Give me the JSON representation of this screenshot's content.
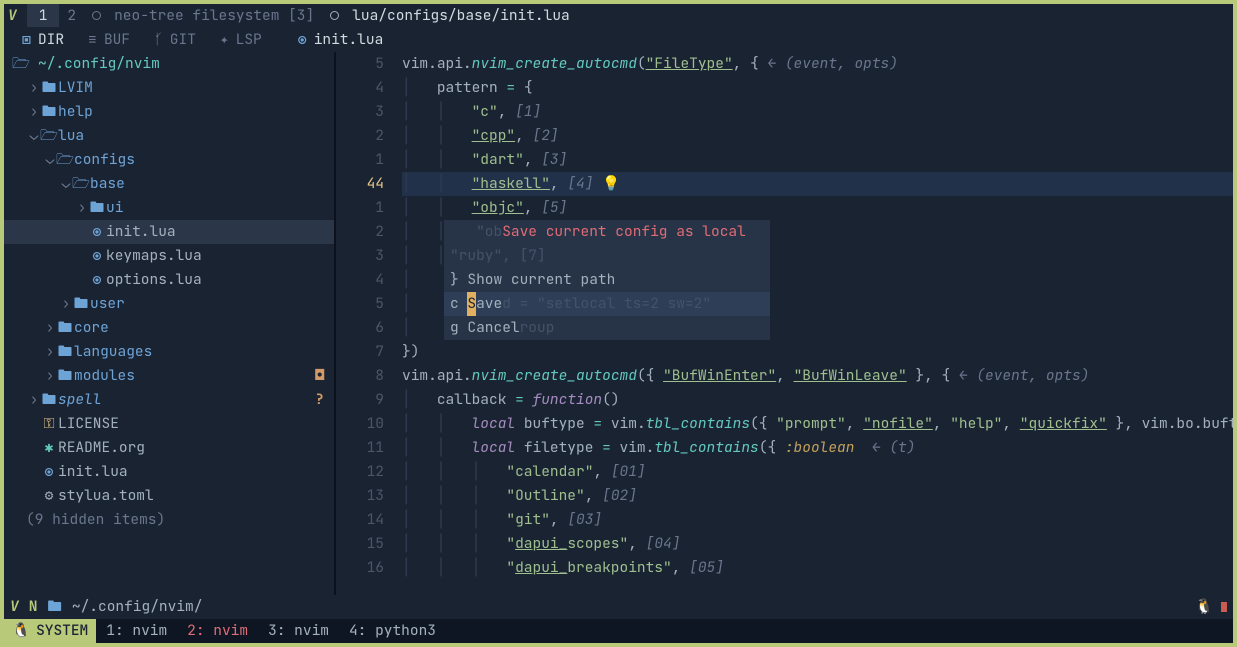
{
  "tabline": {
    "vim_glyph": "V",
    "active_tab": "1",
    "inactive_tab": "2",
    "buf1_label": "neo-tree filesystem [3]",
    "buf2_label": "lua/configs/base/init.lua"
  },
  "sidebar_tabs": {
    "dir": "DIR",
    "buf": "BUF",
    "git": "GIT",
    "lsp": "LSP"
  },
  "filetab": {
    "name": "init.lua"
  },
  "tree": {
    "root": "~/.config/nvim",
    "items": [
      {
        "depth": 1,
        "type": "dir",
        "open": false,
        "name": "LVIM"
      },
      {
        "depth": 1,
        "type": "dir",
        "open": false,
        "name": "help"
      },
      {
        "depth": 1,
        "type": "dir",
        "open": true,
        "name": "lua"
      },
      {
        "depth": 2,
        "type": "dir",
        "open": true,
        "name": "configs"
      },
      {
        "depth": 3,
        "type": "dir",
        "open": true,
        "name": "base"
      },
      {
        "depth": 4,
        "type": "dir",
        "open": false,
        "name": "ui"
      },
      {
        "depth": 4,
        "type": "file",
        "kind": "lua",
        "name": "init.lua",
        "selected": true
      },
      {
        "depth": 4,
        "type": "file",
        "kind": "lua",
        "name": "keymaps.lua"
      },
      {
        "depth": 4,
        "type": "file",
        "kind": "lua",
        "name": "options.lua"
      },
      {
        "depth": 3,
        "type": "dir",
        "open": false,
        "name": "user"
      },
      {
        "depth": 2,
        "type": "dir",
        "open": false,
        "name": "core"
      },
      {
        "depth": 2,
        "type": "dir",
        "open": false,
        "name": "languages"
      },
      {
        "depth": 2,
        "type": "dir",
        "open": false,
        "name": "modules",
        "marker": "dot"
      },
      {
        "depth": 1,
        "type": "dir",
        "open": false,
        "name": "spell",
        "spell": true,
        "marker": "q"
      },
      {
        "depth": 1,
        "type": "file",
        "kind": "key",
        "name": "LICENSE"
      },
      {
        "depth": 1,
        "type": "file",
        "kind": "org",
        "name": "README.org"
      },
      {
        "depth": 1,
        "type": "file",
        "kind": "lua",
        "name": "init.lua"
      },
      {
        "depth": 1,
        "type": "file",
        "kind": "toml",
        "name": "stylua.toml"
      }
    ],
    "hidden": "(9 hidden items)"
  },
  "gutter": [
    "5",
    "4",
    "3",
    "2",
    "1",
    "44",
    "1",
    "2",
    "3",
    "4",
    "5",
    "6",
    "7",
    "8",
    "9",
    "10",
    "11",
    "12",
    "13",
    "14",
    "15",
    "16"
  ],
  "cursor_row_index": 5,
  "code_colors": {
    "vim": "vim",
    "api": "api",
    "fn": "nvim_create_autocmd"
  },
  "popup": {
    "title": "Save current config as local",
    "lines": [
      {
        "key": "}",
        "label": "Show current path"
      },
      {
        "key": "c",
        "label": "Save",
        "sel": true,
        "cursor_char": "S",
        "rest": "ave"
      },
      {
        "key": "g",
        "label": "Cancel"
      }
    ],
    "dim1": "\"objc2\", [6]",
    "dim2": "\"ruby\", [7]",
    "dim3": "   command = \"setlocal ts=2 sw=2\"",
    "dim4": "   augroup"
  },
  "statusline": {
    "vim_glyph": "V",
    "mode": "N",
    "path": "~/.config/nvim/"
  },
  "tmux": {
    "session": "SYSTEM",
    "windows": [
      {
        "idx": "1",
        "name": "nvim"
      },
      {
        "idx": "2",
        "name": "nvim",
        "active": true
      },
      {
        "idx": "3",
        "name": "nvim"
      },
      {
        "idx": "4",
        "name": "python3"
      }
    ]
  }
}
